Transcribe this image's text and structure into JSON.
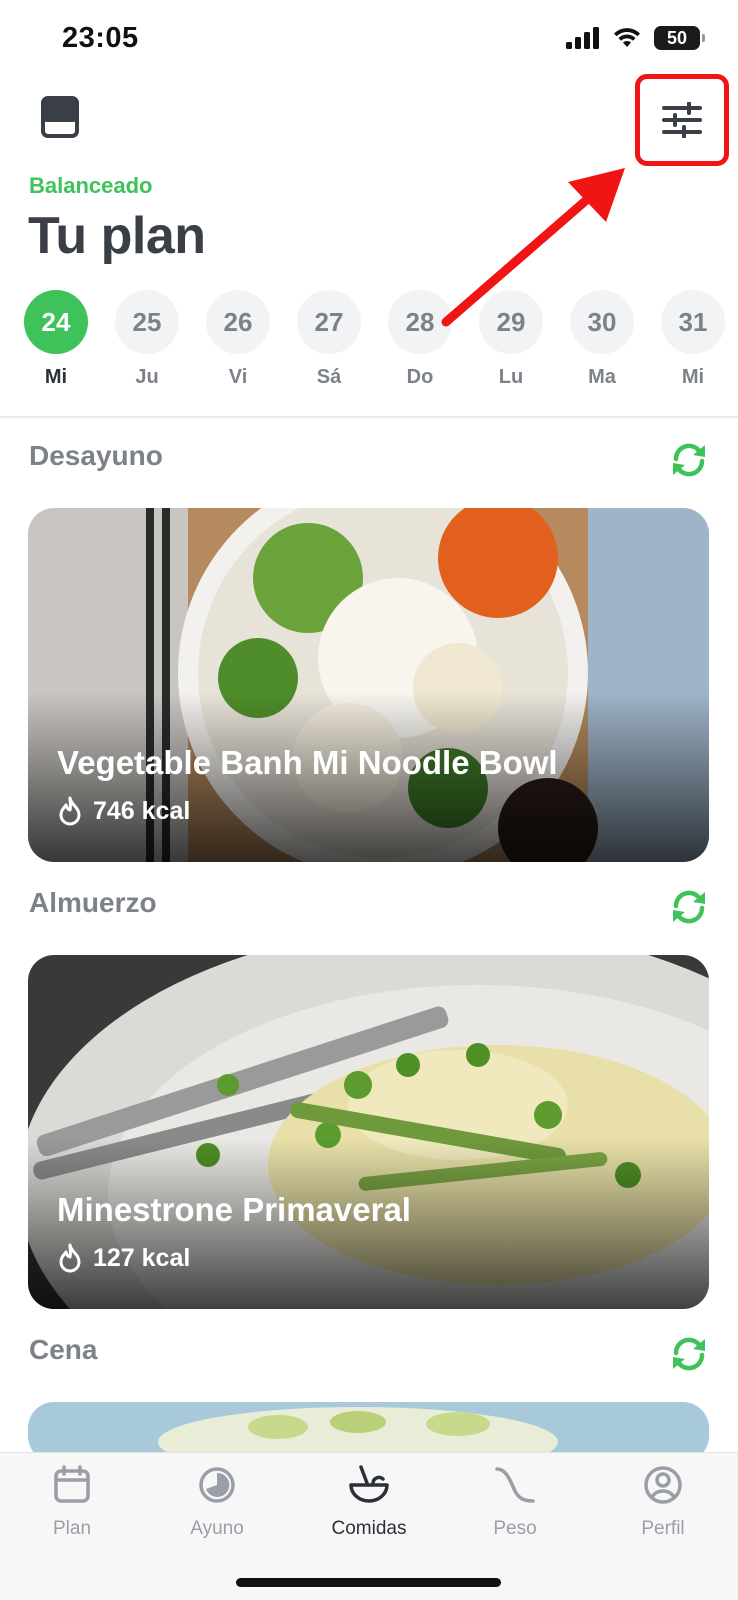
{
  "status_bar": {
    "time": "23:05",
    "battery": "50"
  },
  "header": {
    "diet_type": "Balanceado",
    "title": "Tu plan"
  },
  "days": [
    {
      "number": "24",
      "weekday": "Mi",
      "active": true
    },
    {
      "number": "25",
      "weekday": "Ju",
      "active": false
    },
    {
      "number": "26",
      "weekday": "Vi",
      "active": false
    },
    {
      "number": "27",
      "weekday": "Sá",
      "active": false
    },
    {
      "number": "28",
      "weekday": "Do",
      "active": false
    },
    {
      "number": "29",
      "weekday": "Lu",
      "active": false
    },
    {
      "number": "30",
      "weekday": "Ma",
      "active": false
    },
    {
      "number": "31",
      "weekday": "Mi",
      "active": false
    }
  ],
  "meals": [
    {
      "section": "Desayuno",
      "name": "Vegetable Banh Mi Noodle Bowl",
      "kcal": "746 kcal"
    },
    {
      "section": "Almuerzo",
      "name": "Minestrone Primaveral",
      "kcal": "127 kcal"
    },
    {
      "section": "Cena"
    }
  ],
  "tabs": [
    {
      "label": "Plan",
      "icon": "calendar-icon",
      "active": false
    },
    {
      "label": "Ayuno",
      "icon": "fasting-clock-icon",
      "active": false
    },
    {
      "label": "Comidas",
      "icon": "bowl-icon",
      "active": true
    },
    {
      "label": "Peso",
      "icon": "weight-curve-icon",
      "active": false
    },
    {
      "label": "Perfil",
      "icon": "profile-icon",
      "active": false
    }
  ],
  "colors": {
    "accent": "#3fc25a",
    "annotation": "#f01414",
    "title": "#3a3f47",
    "muted": "#7c818a"
  }
}
